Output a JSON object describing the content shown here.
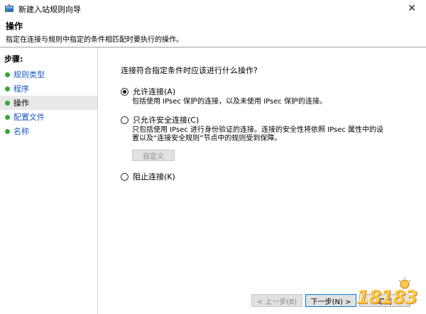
{
  "window": {
    "title": "新建入站规则向导",
    "close_glyph": "✕"
  },
  "header": {
    "title": "操作",
    "description": "指定在连接与规则中指定的条件相匹配时要执行的操作。"
  },
  "steps": {
    "label": "步骤:",
    "items": [
      {
        "label": "规则类型",
        "active": false
      },
      {
        "label": "程序",
        "active": false
      },
      {
        "label": "操作",
        "active": true
      },
      {
        "label": "配置文件",
        "active": false
      },
      {
        "label": "名称",
        "active": false
      }
    ]
  },
  "main": {
    "question": "连接符合指定条件时应该进行什么操作?",
    "options": [
      {
        "label": "允许连接(A)",
        "checked": true,
        "description_lines": [
          "包括使用 IPsec 保护的连接，以及未使用 IPsec 保护的连接。"
        ]
      },
      {
        "label": "只允许安全连接(C)",
        "checked": false,
        "description_lines": [
          "只包括使用 IPsec 进行身份验证的连接。连接的安全性将依照 IPsec 属性中的设",
          "置以及“连接安全规则”节点中的规则受到保障。"
        ]
      },
      {
        "label": "阻止连接(K)",
        "checked": false,
        "description_lines": []
      }
    ],
    "custom_button": "自定义"
  },
  "footer": {
    "back_button": "< 上一步(B)",
    "next_button": "下一步(N) >",
    "cancel_button": "取消"
  },
  "watermark": {
    "text": "18183"
  },
  "colors": {
    "step_dot": "#3aa63a",
    "step_link": "#1a56c4",
    "active_step_bg": "#e8e8e8",
    "primary_border": "#0078d7"
  },
  "icons": {
    "app": "firewall-wizard-icon",
    "close": "close-icon",
    "step": "green-dot-icon"
  }
}
